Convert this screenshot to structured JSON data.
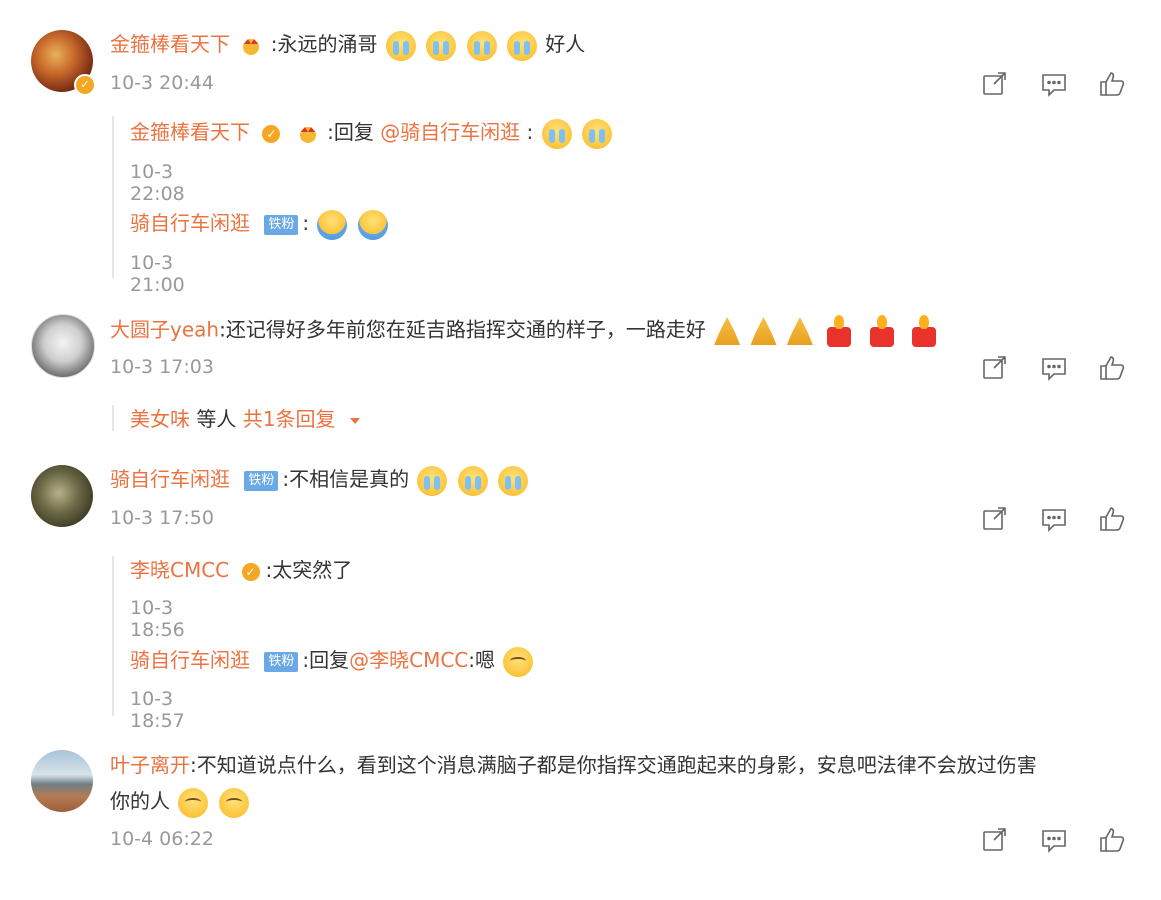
{
  "comments": [
    {
      "user": "金箍棒看天下",
      "text": ":永远的涌哥",
      "suffix": "好人",
      "time": "10-3 20:44",
      "replies": [
        {
          "user": "金箍棒看天下",
          "prefix": ":回复",
          "mention": "@骑自行车闲逛",
          "after": ":",
          "time": "10-3 22:08"
        },
        {
          "user": "骑自行车闲逛",
          "badge": "铁粉",
          "text": ":",
          "time": "10-3 21:00"
        }
      ]
    },
    {
      "user": "大圆子yeah",
      "text": ":还记得好多年前您在延吉路指挥交通的样子，一路走好",
      "time": "10-3 17:03",
      "more": {
        "user": "美女味",
        "middle": " 等人 ",
        "count": "共1条回复"
      }
    },
    {
      "user": "骑自行车闲逛",
      "badge": "铁粉",
      "text": ":不相信是真的",
      "time": "10-3 17:50",
      "replies": [
        {
          "user": "李晓CMCC",
          "text": ":太突然了",
          "time": "10-3 18:56"
        },
        {
          "user": "骑自行车闲逛",
          "badge": "铁粉",
          "prefix": ":回复",
          "mention": "@李晓CMCC",
          "after": ":嗯",
          "time": "10-3 18:57"
        }
      ]
    },
    {
      "user": "叶子离开",
      "text_line1": ":不知道说点什么，看到这个消息满脑子都是你指挥交通跑起来的身影，安息吧法律不会放过伤害",
      "text_line2": "你的人",
      "time": "10-4 06:22"
    }
  ],
  "icons": {
    "share": "share-icon",
    "comment": "comment-icon",
    "like": "like-icon"
  },
  "colors": {
    "name": "#eb7340",
    "time": "#999999",
    "badge": "#6aa8e6",
    "verified": "#f5a623"
  }
}
